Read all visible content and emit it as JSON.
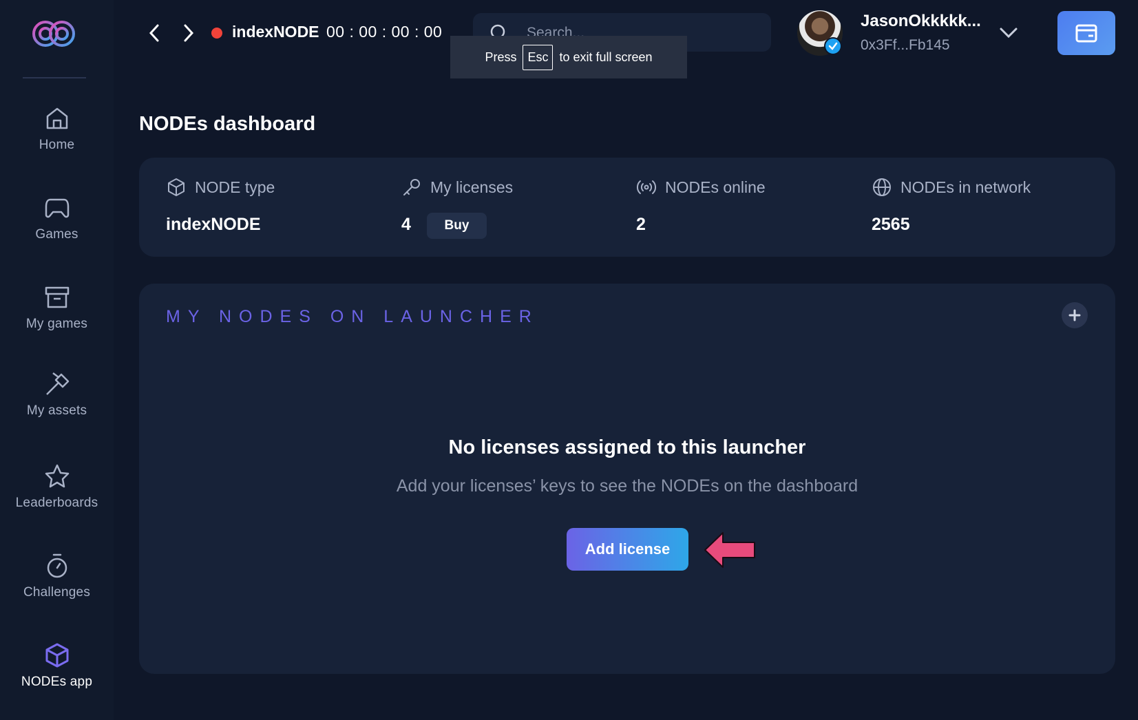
{
  "sidebar": {
    "items": [
      {
        "label": "Home",
        "icon": "home-icon"
      },
      {
        "label": "Games",
        "icon": "gamepad-icon"
      },
      {
        "label": "My games",
        "icon": "archive-icon"
      },
      {
        "label": "My assets",
        "icon": "hammer-icon"
      },
      {
        "label": "Leaderboards",
        "icon": "star-icon"
      },
      {
        "label": "Challenges",
        "icon": "stopwatch-icon"
      },
      {
        "label": "NODEs app",
        "icon": "cube-icon",
        "active": true
      }
    ]
  },
  "topbar": {
    "node_name": "indexNODE",
    "timer": "00 : 00 : 00 : 00",
    "search_placeholder": "Search...",
    "toast_press": "Press",
    "toast_key": "Esc",
    "toast_rest": "to exit full screen"
  },
  "user": {
    "name": "JasonOkkkkk...",
    "address": "0x3Ff...Fb145"
  },
  "page": {
    "title": "NODEs dashboard"
  },
  "stats": {
    "node_type_label": "NODE type",
    "node_type_value": "indexNODE",
    "licenses_label": "My licenses",
    "licenses_value": "4",
    "buy_label": "Buy",
    "online_label": "NODEs online",
    "online_value": "2",
    "network_label": "NODEs in network",
    "network_value": "2565"
  },
  "launcher": {
    "title": "MY NODES ON LAUNCHER",
    "empty_title": "No licenses assigned to this launcher",
    "empty_subtitle": "Add your licenses’ keys to see the NODEs on the dashboard",
    "add_button": "Add license"
  },
  "colors": {
    "background": "#0f1729",
    "card": "#172238",
    "accent_purple": "#6b63e6",
    "accent_blue": "#2ea7e8",
    "record_red": "#f0433a",
    "pointer_pink": "#e84b7c"
  }
}
